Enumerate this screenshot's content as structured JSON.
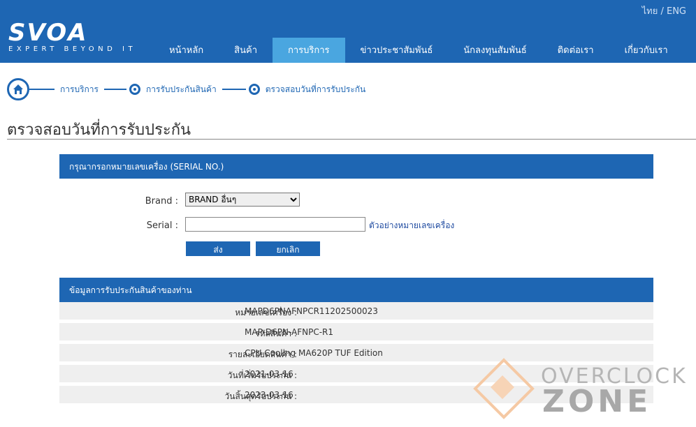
{
  "header": {
    "lang_switch": "ไทย / ENG",
    "logo_text": "SVOA",
    "logo_tagline": "EXPERT BEYOND IT"
  },
  "nav": {
    "items": [
      {
        "label": "หน้าหลัก"
      },
      {
        "label": "สินค้า"
      },
      {
        "label": "การบริการ"
      },
      {
        "label": "ข่าวประชาสัมพันธ์"
      },
      {
        "label": "นักลงทุนสัมพันธ์"
      },
      {
        "label": "ติดต่อเรา"
      },
      {
        "label": "เกี่ยวกับเรา"
      }
    ],
    "active_index": 2
  },
  "breadcrumb": {
    "items": [
      {
        "label": "การบริการ"
      },
      {
        "label": "การรับประกันสินค้า"
      },
      {
        "label": "ตรวจสอบวันที่การรับประกัน"
      }
    ]
  },
  "page_title": "ตรวจสอบวันที่การรับประกัน",
  "form": {
    "header": "กรุณากรอกหมายเลขเครื่อง (SERIAL NO.)",
    "brand_label": "Brand :",
    "brand_value": "BRAND อื่นๆ",
    "serial_label": "Serial :",
    "serial_value": "",
    "example_link": "ตัวอย่างหมายเลขเครื่อง",
    "submit_label": "ส่ง",
    "cancel_label": "ยกเลิก"
  },
  "info": {
    "header": "ข้อมูลการรับประกันสินค้าของท่าน",
    "rows": [
      {
        "label": "หมายเลขเครื่อง :",
        "value": "MAPD6PNAFNPCR11202500023"
      },
      {
        "label": "รหัสสินค้า :",
        "value": "MAP-D6PN-AFNPC-R1"
      },
      {
        "label": "รายละเอียดสินค้า :",
        "value": "CPU Cooling MA620P TUF Edition"
      },
      {
        "label": "วันที่เริ่มรับประกัน :",
        "value": "2021-03-16"
      },
      {
        "label": "วันสิ้นสุดรับประกัน :",
        "value": "2023-03-16"
      }
    ]
  },
  "watermark": {
    "line1": "OVERCLOCK",
    "line2": "ZONE"
  },
  "colors": {
    "primary": "#1e66b3",
    "nav_active": "#4aa6e0",
    "row_bg": "#efefef"
  }
}
